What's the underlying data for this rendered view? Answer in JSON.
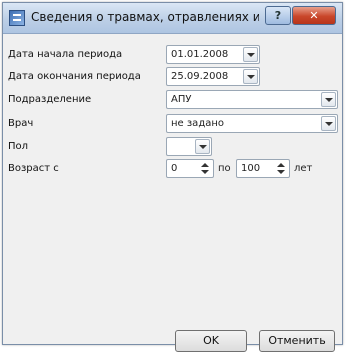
{
  "window": {
    "title": "Сведения о травмах, отравлениях и д...",
    "help_label": "?",
    "close_label": "✕"
  },
  "form": {
    "start_date": {
      "label": "Дата начала периода",
      "value": "01.01.2008"
    },
    "end_date": {
      "label": "Дата окончания периода",
      "value": "25.09.2008"
    },
    "department": {
      "label": "Подразделение",
      "value": "АПУ"
    },
    "doctor": {
      "label": "Врач",
      "value": "не задано"
    },
    "sex": {
      "label": "Пол",
      "value": ""
    },
    "age": {
      "label": "Возраст с",
      "from": "0",
      "to_label": "по",
      "to": "100",
      "unit": "лет"
    }
  },
  "buttons": {
    "ok": "OK",
    "cancel": "Отменить"
  }
}
